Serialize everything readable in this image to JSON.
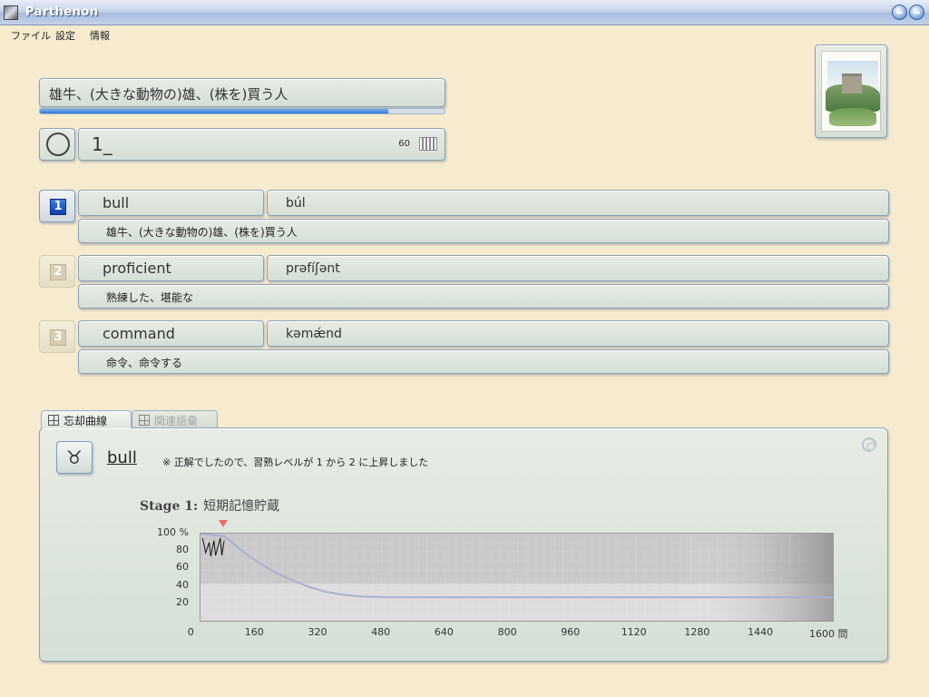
{
  "window": {
    "title": "Parthenon"
  },
  "menu": [
    "ファイル",
    "設定",
    "情報"
  ],
  "quiz": {
    "question": "雄牛、(大きな動物の)雄、(株を)買う人",
    "progress": 0.86,
    "answer_text": "1_",
    "answer_count": "60"
  },
  "choices": [
    {
      "num": "1",
      "word": "bull",
      "pron": "búl",
      "meaning": "雄牛、(大きな動物の)雄、(株を)買う人",
      "active": true
    },
    {
      "num": "2",
      "word": "proficient",
      "pron": "prəfíʃənt",
      "meaning": "熟練した、堪能な",
      "active": false
    },
    {
      "num": "3",
      "word": "command",
      "pron": "kəmǽnd",
      "meaning": "命令、命令する",
      "active": false
    }
  ],
  "tabs": {
    "curve": "忘却曲線",
    "related": "関連語彙"
  },
  "curve": {
    "symbol": "♉",
    "word": "bull",
    "note": "※ 正解でしたので、習熟レベルが 1 から 2 に上昇しました",
    "stage_label": "Stage 1:",
    "stage_name": "短期記憶貯蔵"
  },
  "chart_data": {
    "type": "line",
    "x_ticks": [
      "0",
      "160",
      "320",
      "480",
      "640",
      "800",
      "960",
      "1120",
      "1280",
      "1440",
      "1600 問"
    ],
    "y_ticks": [
      "100 %",
      "80",
      "60",
      "40",
      "20"
    ],
    "xlim": [
      0,
      1600
    ],
    "ylim": [
      0,
      100
    ],
    "marker_x": 60,
    "series": [
      {
        "x": [
          0,
          60,
          80,
          100,
          130,
          160,
          200,
          240,
          280,
          320,
          360,
          400,
          480,
          640,
          800,
          960,
          1120,
          1280,
          1440,
          1600
        ],
        "y": [
          100,
          97,
          90,
          82,
          72,
          63,
          53,
          45,
          38,
          33,
          30,
          28,
          27,
          27,
          27,
          27,
          27,
          27,
          27,
          27
        ]
      }
    ],
    "scribble": {
      "x": [
        5,
        10,
        13,
        22,
        26,
        34,
        38,
        50,
        54,
        60
      ],
      "y": [
        95,
        85,
        78,
        90,
        74,
        92,
        75,
        95,
        75,
        92
      ]
    }
  }
}
